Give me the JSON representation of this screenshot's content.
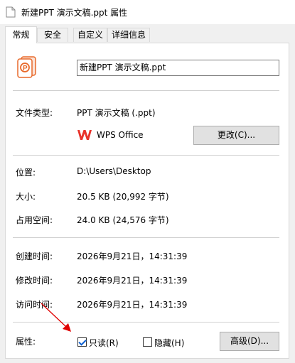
{
  "window": {
    "title": "新建PPT 演示文稿.ppt 属性"
  },
  "tabs": [
    {
      "label": "常规",
      "active": true
    },
    {
      "label": "安全",
      "active": false
    },
    {
      "label": "自定义",
      "active": false
    },
    {
      "label": "详细信息",
      "active": false
    }
  ],
  "file": {
    "name": "新建PPT 演示文稿.ppt",
    "icon": "ppt-file-icon",
    "icon_color": "#e8692a"
  },
  "fields": {
    "type_label": "文件类型:",
    "type_value": "PPT 演示文稿 (.ppt)",
    "open_with_app": "WPS Office",
    "app_icon": "wps-office-icon",
    "app_color": "#e8342c",
    "change_button": "更改(C)...",
    "location_label": "位置:",
    "location_value": "D:\\Users\\Desktop",
    "size_label": "大小:",
    "size_value": "20.5 KB (20,992 字节)",
    "disk_label": "占用空间:",
    "disk_value": "24.0 KB (24,576 字节)",
    "created_label": "创建时间:",
    "created_value": "2026年9月21日，14:31:39",
    "modified_label": "修改时间:",
    "modified_value": "2026年9月21日，14:31:39",
    "accessed_label": "访问时间:",
    "accessed_value": "2026年9月21日，14:31:39"
  },
  "attributes": {
    "label": "属性:",
    "readonly_label": "只读(R)",
    "readonly_checked": true,
    "hidden_label": "隐藏(H)",
    "hidden_checked": false,
    "advanced_button": "高级(D)..."
  },
  "annotation": {
    "arrow_color": "#e00000"
  }
}
